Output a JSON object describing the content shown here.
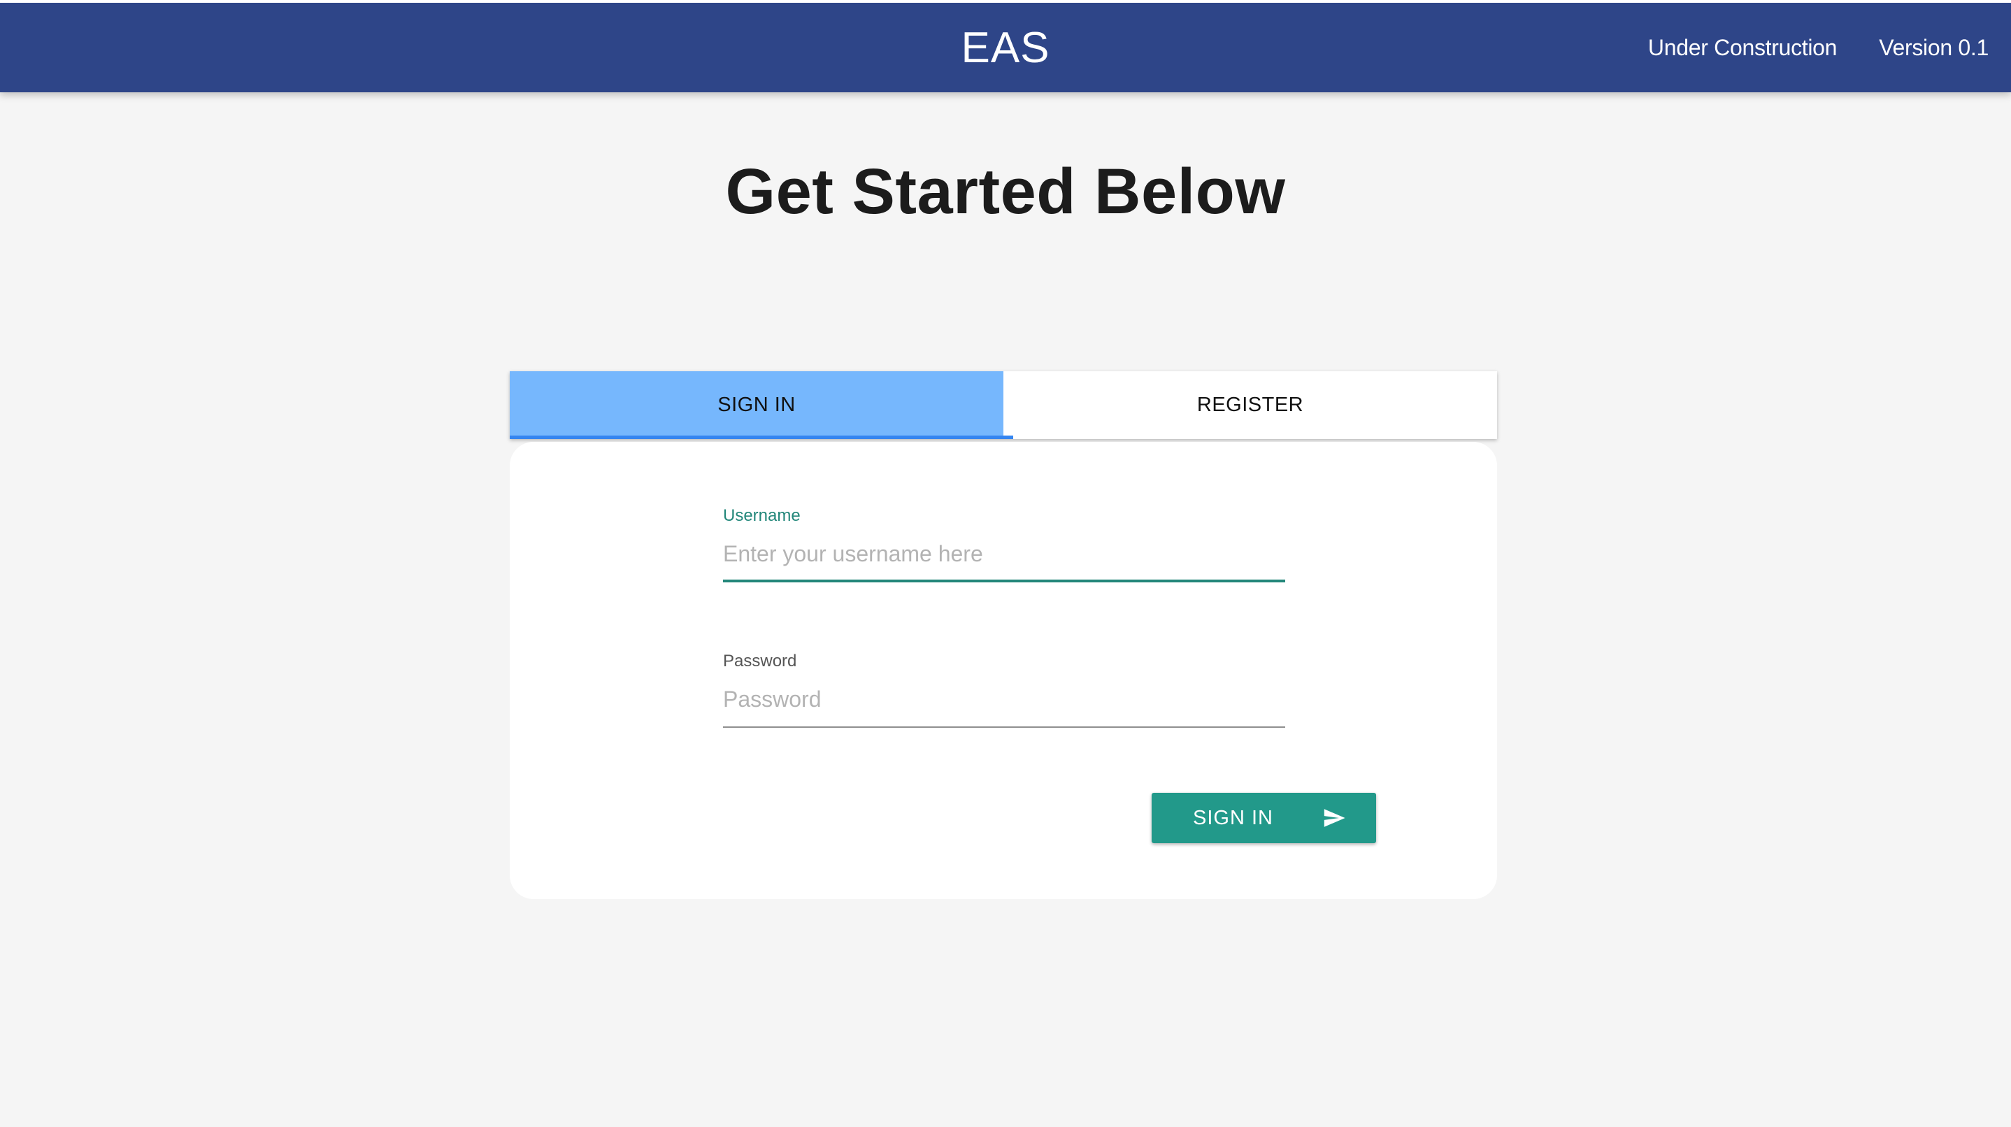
{
  "header": {
    "brand": "EAS",
    "links": [
      {
        "label": "Under Construction"
      },
      {
        "label": "Version 0.1"
      }
    ]
  },
  "page": {
    "title": "Get Started Below"
  },
  "tabs": [
    {
      "label": "SIGN IN",
      "active": true
    },
    {
      "label": "REGISTER",
      "active": false
    }
  ],
  "form": {
    "username": {
      "label": "Username",
      "placeholder": "Enter your username here",
      "value": ""
    },
    "password": {
      "label": "Password",
      "placeholder": "Password",
      "value": ""
    },
    "submit": {
      "label": "SIGN IN",
      "icon": "send-icon"
    }
  },
  "colors": {
    "header_bg": "#2e4588",
    "active_tab": "#76b7fd",
    "tab_indicator": "#3585f0",
    "accent": "#22998a",
    "focus": "#23877a"
  }
}
